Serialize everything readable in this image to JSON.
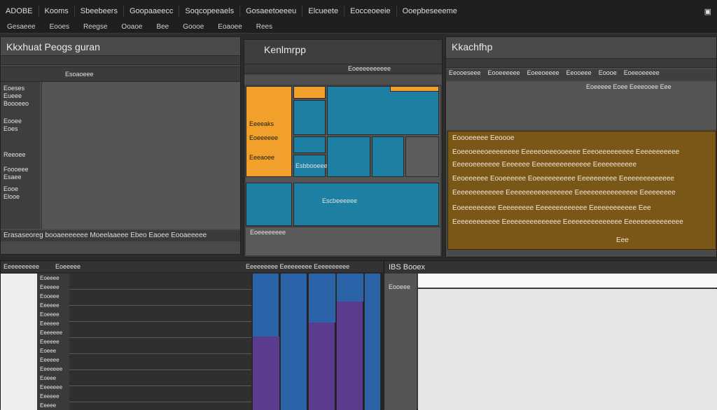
{
  "colors": {
    "bg": "#2b2b2b",
    "panel": "#4a4a4a",
    "orange": "#f0a02b",
    "teal": "#1d7fa2",
    "brown": "#7a5716",
    "purple": "#5a3b8e",
    "blue": "#2a63a8",
    "light": "#eeeeee"
  },
  "topbar": {
    "app_title": "ADOBE",
    "app_sub": "Kooms",
    "menus": [
      "Sbeebeers",
      "Goopaaeecc",
      "Soqcopeeaels",
      "Gosaeetoeeeu",
      "Elcueete",
      "Eocceoeeie",
      "Ooepbeseeeme"
    ],
    "toolbar": [
      "Gesaeee",
      "Eooes",
      "Reegse",
      "Ooaoe",
      "Bee",
      "Goooe",
      "Eoaoee",
      "Rees"
    ]
  },
  "panel_left": {
    "title": "Kkxhuat Peogs guran",
    "header": "Esoaoeee",
    "items": [
      "Eoeses",
      "Eueee",
      "Boooeeo",
      "Eooee",
      "Eoes",
      "Reeoee",
      "Foooeee",
      "Esaee",
      "Eooe",
      "Elooe"
    ],
    "footer": "Erasaseoreg  booaeeeeeee  Moeelaaeee  Ebeo  Eaoee  Eooaeeeee"
  },
  "panel_mid": {
    "title": "Kenlmrpp",
    "ruler": "Eoeeeeeeeeee",
    "labels": [
      "Eeeeaks",
      "Eoeeeeee",
      "Eeeaoee",
      "Esbbooeee"
    ],
    "center_label": "Escbeeeeee",
    "footer_label": "Eoeeeeeeee"
  },
  "panel_right": {
    "title": "Kkachfhp",
    "header_cells": [
      "Eeooeseee",
      "Eooeeeeee",
      "Eoeeoeeee",
      "Eeooeee",
      "Eoooe",
      "Eoeeoeeeee"
    ],
    "status": "Eoeeeee  Eoee  Eeeeooee  Eee",
    "brown_lines": [
      "Eoooeeeee Eeoooe",
      "Eoeeoeeeoeeeeeeee  Eeeeeoeeeooeeee  Eeeoeeeeeeeee  Eeeeeeeeeee",
      "Eeeeoeeeeeee Eeeeeee  Eeeeeeeeeeeeeee  Eeeeeeeeeee",
      "Eeoeeeeee Eooeeeeee  Eoeeeeeeeeee  Eeeeeeeeee  Eeeeeeeeeeeeee",
      "Eeeeeeeeeeeee  Eeeeeeeeeeeeeeeee  Eeeeeeeeeeeeeeee  Eeeeeeeee",
      "Eoeeeeeeeee Eeeeeeeee  Eeeeeeeeeeeee  Eeeeeeeeeeee  Eee",
      "Eeeeeeeeeeee  Eeeeeeeeeeeeeee  Eeeeeeeeeeeeeee  Eeeeeeeeeeeeeee"
    ],
    "brown_footer": "Eee"
  },
  "panel_bottom_left": {
    "title": "Eeeeeeeeee",
    "sub": "Eoeeeee",
    "header": "Eeeeeeeee Eeeeeeeee Eeeeeeeeee",
    "rows": [
      "Eoeeee",
      "Eeeeee",
      "Eooeee",
      "Eeeeee",
      "Eoeeee",
      "Eeeeee",
      "Eeeeeee",
      "Eeeeee",
      "Eoeee",
      "Eeeeee",
      "Eeeeeee",
      "Eoeee",
      "Eeeeeee",
      "Eeeeee",
      "Eeeee"
    ]
  },
  "panel_bottom_right": {
    "title": "IBS  Booex",
    "tab": "Eooeee"
  }
}
